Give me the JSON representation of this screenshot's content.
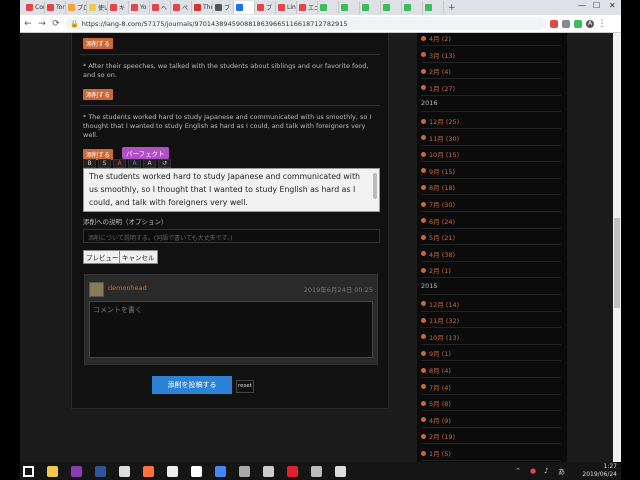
{
  "browser": {
    "tabs": [
      {
        "label": "Cor",
        "color": "#e0474c"
      },
      {
        "label": "Tor",
        "color": "#e0474c"
      },
      {
        "label": "ブロ",
        "color": "#f2a33a"
      },
      {
        "label": "使い",
        "color": "#f2c94c"
      },
      {
        "label": "キ",
        "color": "#e0474c"
      },
      {
        "label": "Yo",
        "color": "#e0474c"
      },
      {
        "label": "ヘ",
        "color": "#e0474c"
      },
      {
        "label": "ペ",
        "color": "#e0474c"
      },
      {
        "label": "The",
        "color": "#d9322e"
      },
      {
        "label": "ブ",
        "color": "#555"
      },
      {
        "label": "",
        "color": "#1a73e8",
        "active": true
      },
      {
        "label": "ブ",
        "color": "#e0474c"
      },
      {
        "label": "Lin",
        "color": "#e0474c"
      },
      {
        "label": "エニ",
        "color": "#e0474c"
      },
      {
        "label": "",
        "color": "#3dbc5a"
      },
      {
        "label": "",
        "color": "#3dbc5a"
      },
      {
        "label": "",
        "color": "#3dbc5a"
      },
      {
        "label": "",
        "color": "#3dbc5a"
      },
      {
        "label": "",
        "color": "#3dbc5a"
      },
      {
        "label": "",
        "color": "#3dbc5a"
      }
    ],
    "new_tab": "+",
    "window_minimize": "—",
    "window_maximize": "☐",
    "window_close": "✕",
    "url": "https://lang-8.com/57175/journals/97014389459088186396651166187127829​15",
    "avatar_letter": "A"
  },
  "journal": {
    "correct_label": "添削する",
    "para1": "* After their speeches, we talked with the students about siblings and our favorite food, and so on.",
    "para2": "* The students worked hard to study Japanese and communicated with us smoothly, so I thought that I wanted to study English as hard as I could, and talk with foreigners very well.",
    "perfect_label": "パーフェクト",
    "format_buttons": [
      "B",
      "S",
      "A",
      "A",
      "A",
      "↺"
    ],
    "editor_text": "The students worked hard to study Japanese and communicated with us smoothly, so I thought that I wanted to study English as hard as I could, and talk with foreigners very well.",
    "explain_label": "添削への説明（オプション）",
    "explain_placeholder": "添削について説明する。(何語で書いても大丈夫です。)",
    "preview_label": "プレビュー",
    "cancel_label": "キャンセル",
    "comment_user": "demonhead",
    "comment_date": "2019年6月24日 00:25",
    "comment_placeholder": "コメントを書く",
    "submit_label": "添削を投稿する",
    "reset_label": "reset"
  },
  "sidebar": {
    "entries": [
      {
        "kind": "month",
        "label": "4月 (2)"
      },
      {
        "kind": "month",
        "label": "3月 (13)"
      },
      {
        "kind": "month",
        "label": "2月 (4)"
      },
      {
        "kind": "month",
        "label": "1月 (27)"
      },
      {
        "kind": "year",
        "label": "2016"
      },
      {
        "kind": "month",
        "label": "12月 (25)"
      },
      {
        "kind": "month",
        "label": "11月 (30)"
      },
      {
        "kind": "month",
        "label": "10月 (15)"
      },
      {
        "kind": "month",
        "label": "9月 (15)"
      },
      {
        "kind": "month",
        "label": "8月 (18)"
      },
      {
        "kind": "month",
        "label": "7月 (30)"
      },
      {
        "kind": "month",
        "label": "6月 (24)"
      },
      {
        "kind": "month",
        "label": "5月 (21)"
      },
      {
        "kind": "month",
        "label": "4月 (38)"
      },
      {
        "kind": "month",
        "label": "2月 (1)"
      },
      {
        "kind": "year",
        "label": "2015"
      },
      {
        "kind": "month",
        "label": "12月 (14)"
      },
      {
        "kind": "month",
        "label": "11月 (32)"
      },
      {
        "kind": "month",
        "label": "10月 (13)"
      },
      {
        "kind": "month",
        "label": "9月 (1)"
      },
      {
        "kind": "month",
        "label": "8月 (4)"
      },
      {
        "kind": "month",
        "label": "7月 (4)"
      },
      {
        "kind": "month",
        "label": "5月 (8)"
      },
      {
        "kind": "month",
        "label": "4月 (9)"
      },
      {
        "kind": "month",
        "label": "2月 (19)"
      },
      {
        "kind": "month",
        "label": "1月 (5)"
      }
    ]
  },
  "taskbar": {
    "apps": [
      {
        "name": "windows-start-icon",
        "color": "#ffffff"
      },
      {
        "name": "file-explorer-icon",
        "color": "#f2c94c"
      },
      {
        "name": "onenote-icon",
        "color": "#8a3bb5"
      },
      {
        "name": "word-icon",
        "color": "#2b579a"
      },
      {
        "name": "notepad-icon",
        "color": "#ddd"
      },
      {
        "name": "firefox-icon",
        "color": "#ff7139"
      },
      {
        "name": "obs-icon",
        "color": "#eee"
      },
      {
        "name": "blank-doc-icon",
        "color": "#fff"
      },
      {
        "name": "chrome-icon",
        "color": "#4285f4"
      },
      {
        "name": "tool-icon",
        "color": "#aaa"
      },
      {
        "name": "calculator-icon",
        "color": "#ccc"
      },
      {
        "name": "opera-icon",
        "color": "#e0202e"
      },
      {
        "name": "app-icon",
        "color": "#bbb"
      },
      {
        "name": "camera-icon",
        "color": "#ddd"
      }
    ],
    "time": "1:27",
    "date": "2019/06/24",
    "language": "あ"
  }
}
